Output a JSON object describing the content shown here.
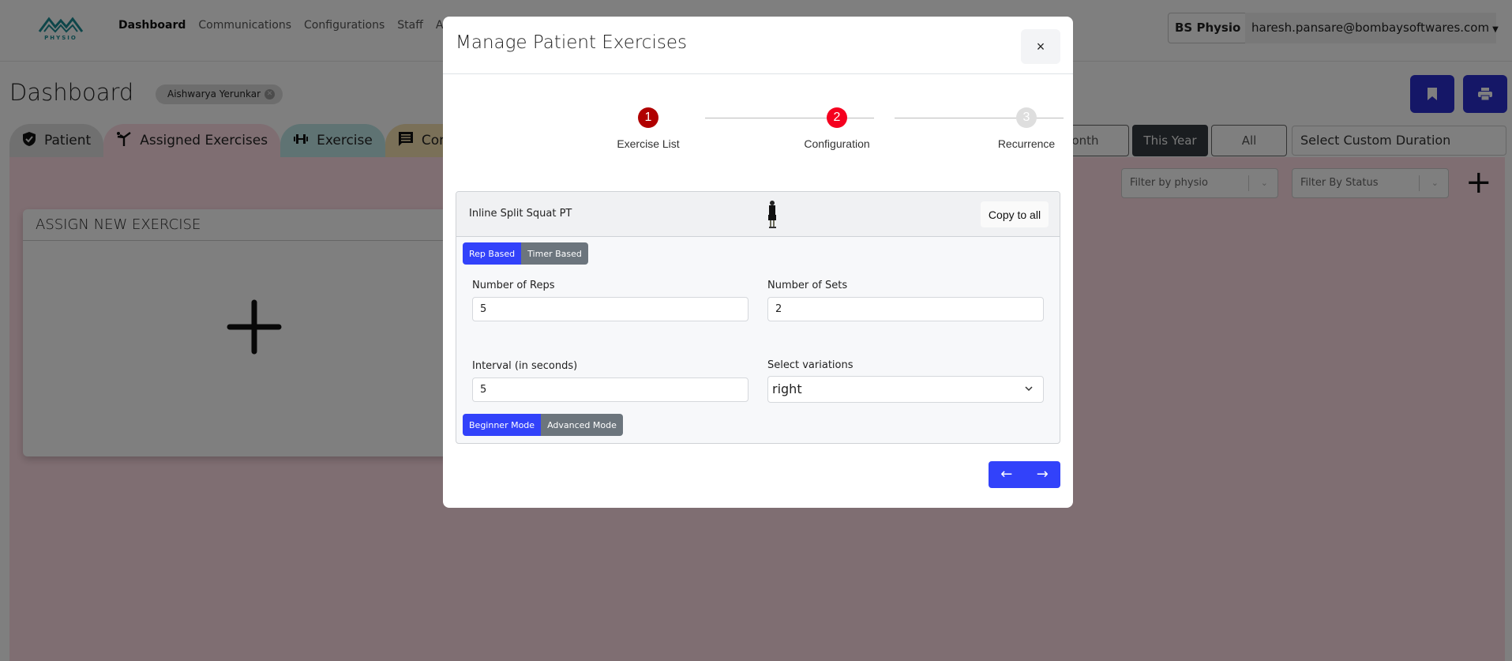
{
  "topnav": {
    "logo_text": "PHYSIO",
    "links": [
      "Dashboard",
      "Communications",
      "Configurations",
      "Staff",
      "Audit Logs"
    ],
    "active_link": "Dashboard",
    "org_label": "BS Physio",
    "user_email": "haresh.pansare@bombaysoftwares.com"
  },
  "page": {
    "title": "Dashboard",
    "patient_chip": "Aishwarya Yerunkar"
  },
  "tabs": [
    {
      "label": "Patient",
      "icon": "shield-check-icon",
      "color": "#e0e0e0"
    },
    {
      "label": "Assigned Exercises",
      "icon": "kick-icon",
      "color": "#ffdde5"
    },
    {
      "label": "Exercise",
      "icon": "dumbbell-icon",
      "color": "#bfe6e6"
    },
    {
      "label": "Communications",
      "icon": "message-icon",
      "color": "#f5e1b0"
    }
  ],
  "date_range": {
    "options": [
      "Last Month",
      "This Year",
      "All"
    ],
    "selected": "This Year",
    "custom_placeholder": "Select Custom Duration"
  },
  "filters": {
    "physio_placeholder": "Filter by physio",
    "status_placeholder": "Filter By Status"
  },
  "assign_card": {
    "title": "ASSIGN NEW EXERCISE"
  },
  "modal": {
    "title": "Manage Patient Exercises",
    "close_label": "×",
    "steps": [
      {
        "number": "1",
        "label": "Exercise List",
        "state": "complete",
        "color": "#b00000"
      },
      {
        "number": "2",
        "label": "Configuration",
        "state": "active",
        "color": "#f5001f"
      },
      {
        "number": "3",
        "label": "Recurrence",
        "state": "pending",
        "color": "#dedede"
      }
    ],
    "exercise": {
      "name": "Inline Split Squat PT",
      "copy_label": "Copy to all",
      "type_options": [
        "Rep Based",
        "Timer Based"
      ],
      "type_selected": "Rep Based",
      "reps_label": "Number of Reps",
      "reps_value": "5",
      "sets_label": "Number of Sets",
      "sets_value": "2",
      "interval_label": "Interval (in seconds)",
      "interval_value": "5",
      "variation_label": "Select variations",
      "variation_value": "right",
      "mode_options": [
        "Beginner Mode",
        "Advanced Mode"
      ],
      "mode_selected": "Beginner Mode"
    },
    "prev_label": "←",
    "next_label": "→"
  },
  "colors": {
    "primary": "#3242fa",
    "secondary": "#6c757d",
    "header_icon_btn": "#2a2ecf",
    "teal_logo": "#1c8c94"
  }
}
